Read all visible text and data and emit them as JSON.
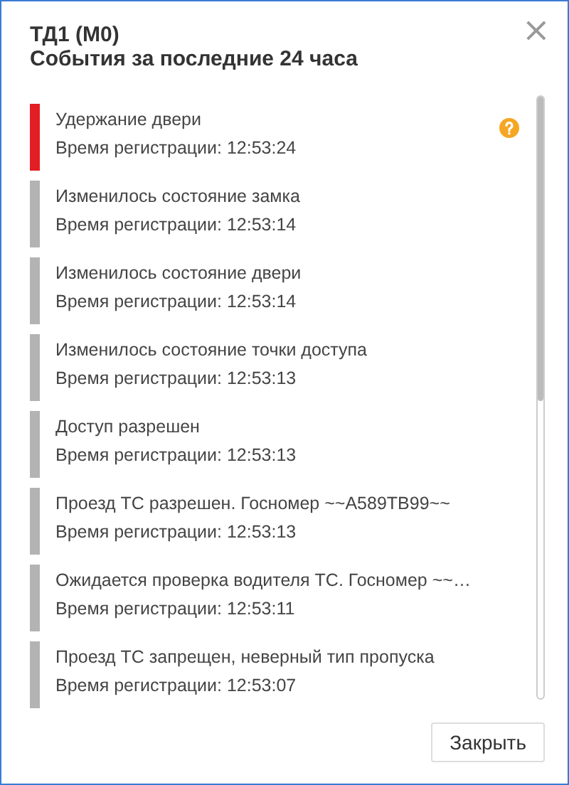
{
  "dialog": {
    "title": "ТД1 (М0)",
    "subtitle": "События за последние 24 часа",
    "close_icon": "×"
  },
  "events": [
    {
      "text": "Удержание двери",
      "time": "Время регистрации: 12:53:24",
      "color": "#e31e24",
      "help_icon": true
    },
    {
      "text": "Изменилось состояние замка",
      "time": "Время регистрации: 12:53:14",
      "color": "#b3b3b3",
      "help_icon": false
    },
    {
      "text": "Изменилось состояние двери",
      "time": "Время регистрации: 12:53:14",
      "color": "#b3b3b3",
      "help_icon": false
    },
    {
      "text": "Изменилось состояние точки доступа",
      "time": "Время регистрации: 12:53:13",
      "color": "#b3b3b3",
      "help_icon": false
    },
    {
      "text": "Доступ разрешен",
      "time": "Время регистрации: 12:53:13",
      "color": "#b3b3b3",
      "help_icon": false
    },
    {
      "text": "Проезд ТС разрешен. Госномер ~~А589ТВ99~~",
      "time": "Время регистрации: 12:53:13",
      "color": "#b3b3b3",
      "help_icon": false
    },
    {
      "text": "Ожидается проверка водителя ТС. Госномер ~~…",
      "time": "Время регистрации: 12:53:11",
      "color": "#b3b3b3",
      "help_icon": false
    },
    {
      "text": "Проезд ТС запрещен, неверный тип пропуска",
      "time": "Время регистрации: 12:53:07",
      "color": "#b3b3b3",
      "help_icon": false
    }
  ],
  "buttons": [
    "Закрыть"
  ]
}
